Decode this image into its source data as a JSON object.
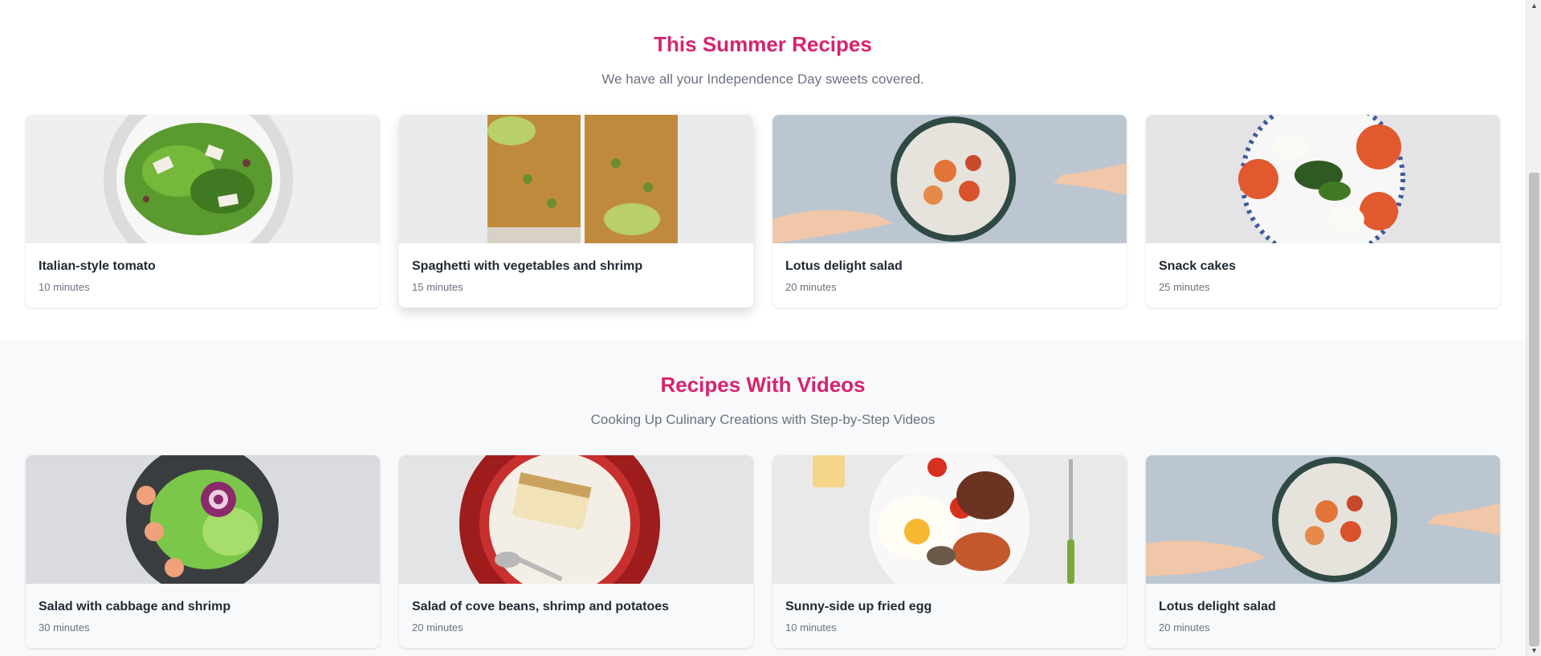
{
  "summer": {
    "title": "This Summer Recipes",
    "subtitle": "We have all your Independence Day sweets covered.",
    "recipes": [
      {
        "title": "Italian-style tomato",
        "time": "10 minutes"
      },
      {
        "title": "Spaghetti with vegetables and shrimp",
        "time": "15 minutes"
      },
      {
        "title": "Lotus delight salad",
        "time": "20 minutes"
      },
      {
        "title": "Snack cakes",
        "time": "25 minutes"
      }
    ]
  },
  "videos": {
    "title": "Recipes With Videos",
    "subtitle": "Cooking Up Culinary Creations with Step-by-Step Videos",
    "recipes": [
      {
        "title": "Salad with cabbage and shrimp",
        "time": "30 minutes"
      },
      {
        "title": "Salad of cove beans, shrimp and potatoes",
        "time": "20 minutes"
      },
      {
        "title": "Sunny-side up fried egg",
        "time": "10 minutes"
      },
      {
        "title": "Lotus delight salad",
        "time": "20 minutes"
      }
    ]
  },
  "colors": {
    "accent": "#d6246e",
    "muted_text": "#6b7280",
    "alt_section_bg": "#f8f9fa"
  },
  "icons": {
    "scroll_up": "triangle-up-icon",
    "scroll_down": "triangle-down-icon"
  }
}
